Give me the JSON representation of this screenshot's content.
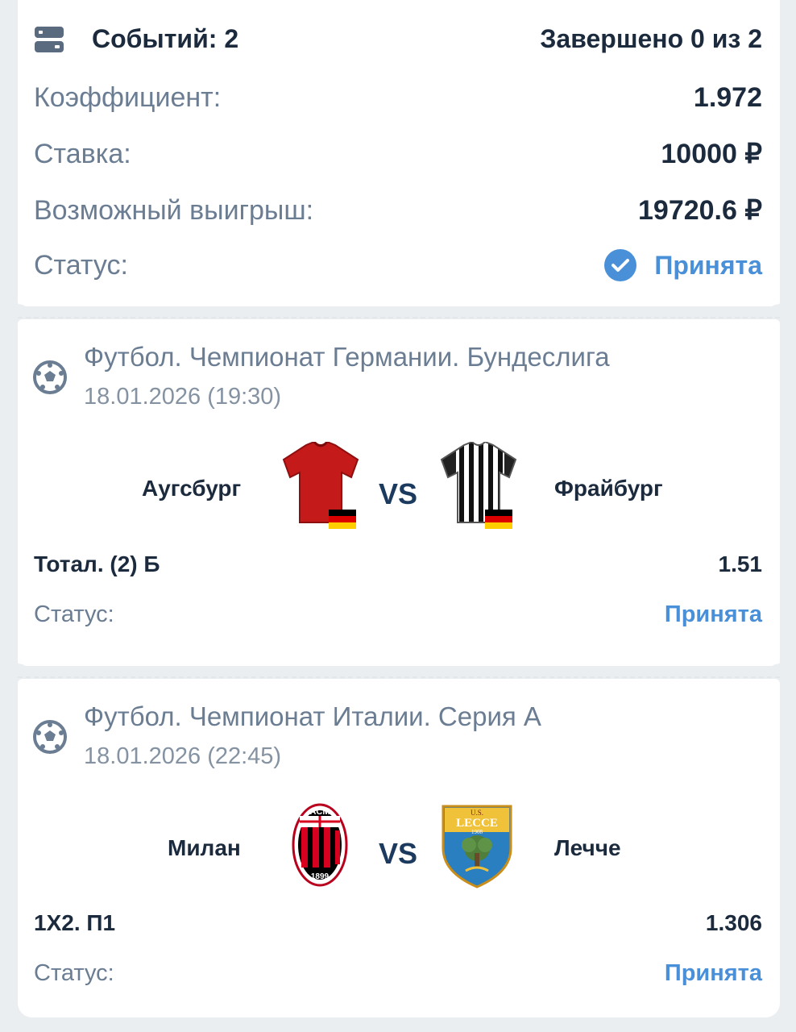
{
  "summary": {
    "events_label": "Событий: 2",
    "completed_label": "Завершено 0 из 2",
    "coefficient_label": "Коэффициент:",
    "coefficient_value": "1.972",
    "stake_label": "Ставка:",
    "stake_value": "10000 ₽",
    "payout_label": "Возможный выигрыш:",
    "payout_value": "19720.6 ₽",
    "status_label": "Статус:",
    "status_value": "Принята"
  },
  "events": [
    {
      "league": "Футбол. Чемпионат Германии. Бундеслига",
      "date": "18.01.2026 (19:30)",
      "home_team": "Аугсбург",
      "away_team": "Фрайбург",
      "vs": "VS",
      "market": "Тотал. (2) Б",
      "odd": "1.51",
      "status_label": "Статус:",
      "status_value": "Принята"
    },
    {
      "league": "Футбол. Чемпионат Италии. Серия А",
      "date": "18.01.2026 (22:45)",
      "home_team": "Милан",
      "away_team": "Лечче",
      "vs": "VS",
      "market": "1X2. П1",
      "odd": "1.306",
      "status_label": "Статус:",
      "status_value": "Принята",
      "home_logo_text": [
        "ACM",
        "1899"
      ],
      "away_logo_text": [
        "U.S.",
        "LECCE",
        "1908"
      ]
    }
  ],
  "colors": {
    "background": "#ebeef1",
    "accent": "#4a90d9",
    "text_dark": "#1c2a3d",
    "text_muted": "#6b7d92"
  },
  "icons": [
    "ticket-icon",
    "check-circle-icon",
    "soccer-ball-icon",
    "jersey-icon",
    "germany-flag-icon",
    "club-crest-icon"
  ]
}
